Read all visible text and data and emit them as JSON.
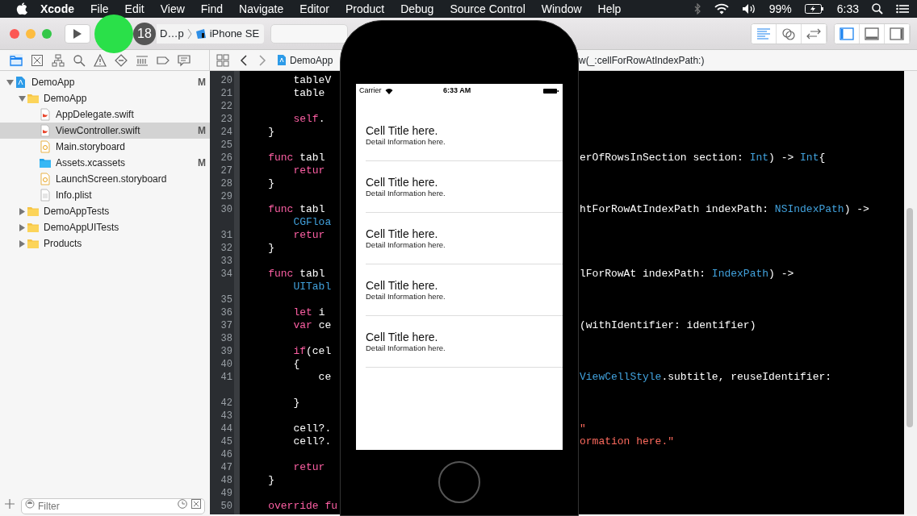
{
  "menubar": {
    "app": "Xcode",
    "menus": [
      "File",
      "Edit",
      "View",
      "Find",
      "Navigate",
      "Editor",
      "Product",
      "Debug",
      "Source Control",
      "Window",
      "Help"
    ],
    "battery_percent": "99%",
    "clock": "6:33"
  },
  "toolbar": {
    "badge": "18",
    "scheme": "D…p",
    "destination": "iPhone SE",
    "editor_modes": [
      {
        "kind": "standard",
        "selected": true
      },
      {
        "kind": "assistant",
        "selected": false
      },
      {
        "kind": "version",
        "selected": false
      }
    ],
    "panels": [
      {
        "kind": "navigator",
        "selected": true
      },
      {
        "kind": "debug",
        "selected": false
      },
      {
        "kind": "utilities",
        "selected": false
      }
    ]
  },
  "navigator_tabs": [
    {
      "kind": "project",
      "selected": true
    },
    {
      "kind": "source",
      "selected": false
    },
    {
      "kind": "symbol",
      "selected": false
    },
    {
      "kind": "find",
      "selected": false
    },
    {
      "kind": "issue",
      "selected": false
    },
    {
      "kind": "test",
      "selected": false
    },
    {
      "kind": "debug",
      "selected": false
    },
    {
      "kind": "breakpoint",
      "selected": false
    },
    {
      "kind": "report",
      "selected": false
    }
  ],
  "jump_bar": {
    "file": "DemoApp",
    "symbol": "w(_:cellForRowAtIndexPath:)"
  },
  "file_tree": [
    {
      "name": "DemoApp",
      "kind": "project",
      "status": "M",
      "expanded": true,
      "selected": false,
      "children": [
        {
          "name": "DemoApp",
          "kind": "folder",
          "expanded": true,
          "selected": false,
          "children": [
            {
              "name": "AppDelegate.swift",
              "kind": "swift",
              "selected": false
            },
            {
              "name": "ViewController.swift",
              "kind": "swift",
              "status": "M",
              "selected": true
            },
            {
              "name": "Main.storyboard",
              "kind": "storyboard",
              "selected": false
            },
            {
              "name": "Assets.xcassets",
              "kind": "assets",
              "status": "M",
              "selected": false
            },
            {
              "name": "LaunchScreen.storyboard",
              "kind": "storyboard",
              "selected": false
            },
            {
              "name": "Info.plist",
              "kind": "plist",
              "selected": false
            }
          ]
        },
        {
          "name": "DemoAppTests",
          "kind": "folder",
          "expanded": false,
          "selected": false
        },
        {
          "name": "DemoAppUITests",
          "kind": "folder",
          "expanded": false,
          "selected": false
        },
        {
          "name": "Products",
          "kind": "folder",
          "expanded": false,
          "selected": false
        }
      ]
    }
  ],
  "filter": {
    "placeholder": "Filter"
  },
  "code_lines": [
    {
      "kind": "line",
      "number": "20",
      "left": [
        {
          "kind": "plain",
          "text": "        tableV"
        }
      ]
    },
    {
      "kind": "line",
      "number": "21",
      "left": [
        {
          "kind": "plain",
          "text": "        table"
        }
      ]
    },
    {
      "kind": "line",
      "number": "22"
    },
    {
      "kind": "line",
      "number": "23",
      "left": [
        {
          "kind": "keyword",
          "text": "        self"
        },
        {
          "kind": "plain",
          "text": "."
        }
      ]
    },
    {
      "kind": "line",
      "number": "24",
      "left": [
        {
          "kind": "plain",
          "text": "    }"
        }
      ]
    },
    {
      "kind": "line",
      "number": "25"
    },
    {
      "kind": "line",
      "number": "26",
      "left": [
        {
          "kind": "keyword",
          "text": "    func"
        },
        {
          "kind": "plain",
          "text": " tabl"
        }
      ],
      "right": [
        {
          "kind": "plain",
          "text": "erOfRowsInSection section: "
        },
        {
          "kind": "type",
          "text": "Int"
        },
        {
          "kind": "plain",
          "text": ") -> "
        },
        {
          "kind": "type",
          "text": "Int"
        },
        {
          "kind": "plain",
          "text": "{"
        }
      ]
    },
    {
      "kind": "line",
      "number": "27",
      "left": [
        {
          "kind": "keyword",
          "text": "        retur"
        }
      ]
    },
    {
      "kind": "line",
      "number": "28",
      "left": [
        {
          "kind": "plain",
          "text": "    }"
        }
      ]
    },
    {
      "kind": "line",
      "number": "29"
    },
    {
      "kind": "line",
      "number": "30",
      "left": [
        {
          "kind": "keyword",
          "text": "    func"
        },
        {
          "kind": "plain",
          "text": " tabl"
        }
      ],
      "right": [
        {
          "kind": "plain",
          "text": "htForRowAtIndexPath indexPath: "
        },
        {
          "kind": "type",
          "text": "NSIndexPath"
        },
        {
          "kind": "plain",
          "text": ") ->"
        }
      ]
    },
    {
      "kind": "continuation",
      "left": [
        {
          "kind": "type",
          "text": "        CGFloa"
        }
      ]
    },
    {
      "kind": "line",
      "number": "31",
      "left": [
        {
          "kind": "keyword",
          "text": "        retur"
        }
      ]
    },
    {
      "kind": "line",
      "number": "32",
      "left": [
        {
          "kind": "plain",
          "text": "    }"
        }
      ]
    },
    {
      "kind": "line",
      "number": "33"
    },
    {
      "kind": "line",
      "number": "34",
      "left": [
        {
          "kind": "keyword",
          "text": "    func"
        },
        {
          "kind": "plain",
          "text": " tabl"
        }
      ],
      "right": [
        {
          "kind": "plain",
          "text": "lForRowAt indexPath: "
        },
        {
          "kind": "type",
          "text": "IndexPath"
        },
        {
          "kind": "plain",
          "text": ") ->"
        }
      ]
    },
    {
      "kind": "continuation",
      "left": [
        {
          "kind": "type",
          "text": "        UITabl"
        }
      ]
    },
    {
      "kind": "line",
      "number": "35"
    },
    {
      "kind": "line",
      "number": "36",
      "left": [
        {
          "kind": "keyword",
          "text": "        let"
        },
        {
          "kind": "plain",
          "text": " i"
        }
      ]
    },
    {
      "kind": "line",
      "number": "37",
      "left": [
        {
          "kind": "keyword",
          "text": "        var"
        },
        {
          "kind": "plain",
          "text": " ce"
        }
      ],
      "right": [
        {
          "kind": "plain",
          "text": "(withIdentifier: identifier)"
        }
      ]
    },
    {
      "kind": "line",
      "number": "38"
    },
    {
      "kind": "line",
      "number": "39",
      "left": [
        {
          "kind": "keyword",
          "text": "        if"
        },
        {
          "kind": "plain",
          "text": "(cel"
        }
      ]
    },
    {
      "kind": "line",
      "number": "40",
      "left": [
        {
          "kind": "plain",
          "text": "        {"
        }
      ]
    },
    {
      "kind": "line",
      "number": "41",
      "left": [
        {
          "kind": "plain",
          "text": "            ce"
        }
      ],
      "right": [
        {
          "kind": "type",
          "text": "ViewCellStyle"
        },
        {
          "kind": "plain",
          "text": ".subtitle, reuseIdentifier:"
        }
      ]
    },
    {
      "kind": "continuation"
    },
    {
      "kind": "line",
      "number": "42",
      "left": [
        {
          "kind": "plain",
          "text": "        }"
        }
      ]
    },
    {
      "kind": "line",
      "number": "43"
    },
    {
      "kind": "line",
      "number": "44",
      "left": [
        {
          "kind": "plain",
          "text": "        cell?."
        }
      ],
      "right": [
        {
          "kind": "string",
          "text": "\""
        }
      ]
    },
    {
      "kind": "line",
      "number": "45",
      "left": [
        {
          "kind": "plain",
          "text": "        cell?."
        }
      ],
      "right": [
        {
          "kind": "string",
          "text": "ormation here.\""
        }
      ]
    },
    {
      "kind": "line",
      "number": "46"
    },
    {
      "kind": "line",
      "number": "47",
      "left": [
        {
          "kind": "keyword",
          "text": "        retur"
        }
      ]
    },
    {
      "kind": "line",
      "number": "48",
      "left": [
        {
          "kind": "plain",
          "text": "    }"
        }
      ]
    },
    {
      "kind": "line",
      "number": "49"
    },
    {
      "kind": "line",
      "number": "50",
      "left": [
        {
          "kind": "keyword",
          "text": "    override fu"
        }
      ]
    }
  ],
  "simulator": {
    "carrier": "Carrier",
    "time": "6:33 AM",
    "cells": [
      {
        "title": "Cell Title here.",
        "detail": "Detail Information here."
      },
      {
        "title": "Cell Title here.",
        "detail": "Detail Information here."
      },
      {
        "title": "Cell Title here.",
        "detail": "Detail Information here."
      },
      {
        "title": "Cell Title here.",
        "detail": "Detail Information here."
      },
      {
        "title": "Cell Title here.",
        "detail": "Detail Information here."
      }
    ]
  }
}
